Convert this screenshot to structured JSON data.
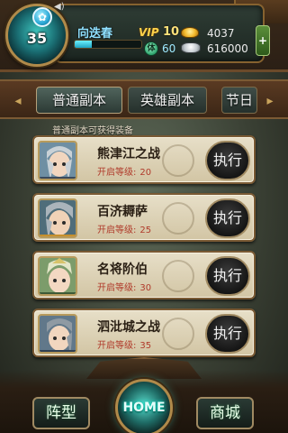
{
  "player": {
    "level": "35",
    "name": "向迭春",
    "vip_label": "VIP",
    "vip_level": "10",
    "exp_fraction": 0.25,
    "gold": "4037",
    "stamina_label": "体",
    "stamina": "60",
    "silver": "616000",
    "plus_label": "+"
  },
  "tabs": [
    {
      "label": "普通副本",
      "active": true
    },
    {
      "label": "英雄副本",
      "active": false
    },
    {
      "label": "节日",
      "active": false
    }
  ],
  "list_header": "普通副本可获得装备",
  "dungeons": [
    {
      "title": "熊津江之战",
      "level_label": "开启等级:",
      "level": "20",
      "action": "执行"
    },
    {
      "title": "百济耨萨",
      "level_label": "开启等级:",
      "level": "25",
      "action": "执行"
    },
    {
      "title": "名将阶伯",
      "level_label": "开启等级:",
      "level": "30",
      "action": "执行"
    },
    {
      "title": "泗沘城之战",
      "level_label": "开启等级:",
      "level": "35",
      "action": "执行"
    }
  ],
  "bottom_nav": {
    "formation_label": "阵型",
    "home_label": "HOME",
    "shop_label": "商城"
  },
  "colors": {
    "accent_gold": "#ffd24a",
    "name_cyan": "#8fe0ff",
    "level_red": "#b03a2a"
  }
}
